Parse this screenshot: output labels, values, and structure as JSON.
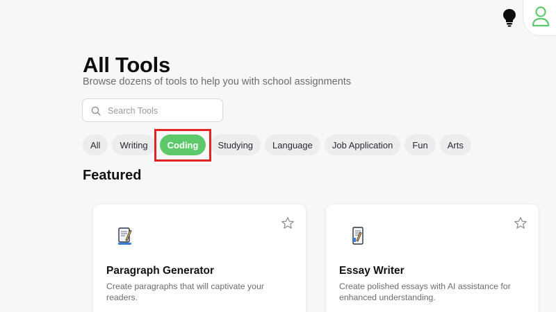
{
  "header": {
    "title": "All Tools",
    "subtitle": "Browse dozens of tools to help you with school assignments"
  },
  "top_bar": {
    "icons": [
      "lightbulb-icon",
      "user-icon"
    ]
  },
  "search": {
    "placeholder": "Search Tools",
    "value": "",
    "icon": "search-icon"
  },
  "categories": {
    "items": [
      {
        "label": "All"
      },
      {
        "label": "Writing"
      },
      {
        "label": "Coding"
      },
      {
        "label": "Studying"
      },
      {
        "label": "Language"
      },
      {
        "label": "Job Application"
      },
      {
        "label": "Fun"
      },
      {
        "label": "Arts"
      }
    ],
    "selected": "Coding",
    "active_color": "#5ec96b",
    "highlight_color": "#e02424"
  },
  "featured": {
    "title": "Featured",
    "cards": [
      {
        "title": "Paragraph Generator",
        "description": "Create paragraphs that will captivate your readers.",
        "icon": "document-pencil-icon"
      },
      {
        "title": "Essay Writer",
        "description": "Create polished essays with AI assistance for enhanced understanding.",
        "icon": "document-pencil-icon"
      }
    ]
  },
  "colors": {
    "accent": "#5ec96b",
    "background": "#f7f7f8"
  }
}
